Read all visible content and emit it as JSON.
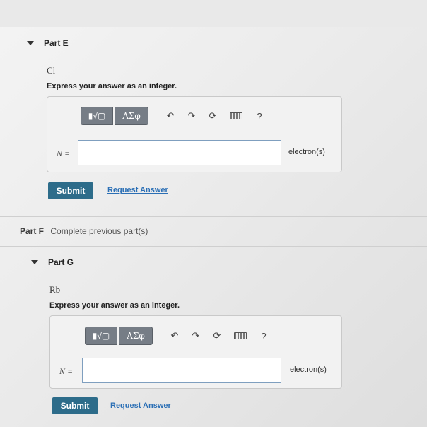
{
  "parts": [
    {
      "label": "Part E",
      "element": "Cl",
      "instruction": "Express your answer as an integer.",
      "toolbar": {
        "templates_symbol": "▮√▢",
        "symbols_label": "ΑΣφ",
        "undo_symbol": "↶",
        "redo_symbol": "↷",
        "reset_symbol": "⟳",
        "help_label": "?"
      },
      "variable_label": "N =",
      "input_value": "",
      "units": "electron(s)",
      "submit_label": "Submit",
      "request_label": "Request Answer"
    },
    {
      "label": "Part G",
      "element": "Rb",
      "instruction": "Express your answer as an integer.",
      "toolbar": {
        "templates_symbol": "▮√▢",
        "symbols_label": "ΑΣφ",
        "undo_symbol": "↶",
        "redo_symbol": "↷",
        "reset_symbol": "⟳",
        "help_label": "?"
      },
      "variable_label": "N =",
      "input_value": "",
      "units": "electron(s)",
      "submit_label": "Submit",
      "request_label": "Request Answer"
    }
  ],
  "part_f": {
    "label": "Part F",
    "message": "Complete previous part(s)"
  },
  "colors": {
    "submit_bg": "#2d6c8a",
    "link": "#2b6fb5",
    "toolbar_bg": "#767d86"
  }
}
